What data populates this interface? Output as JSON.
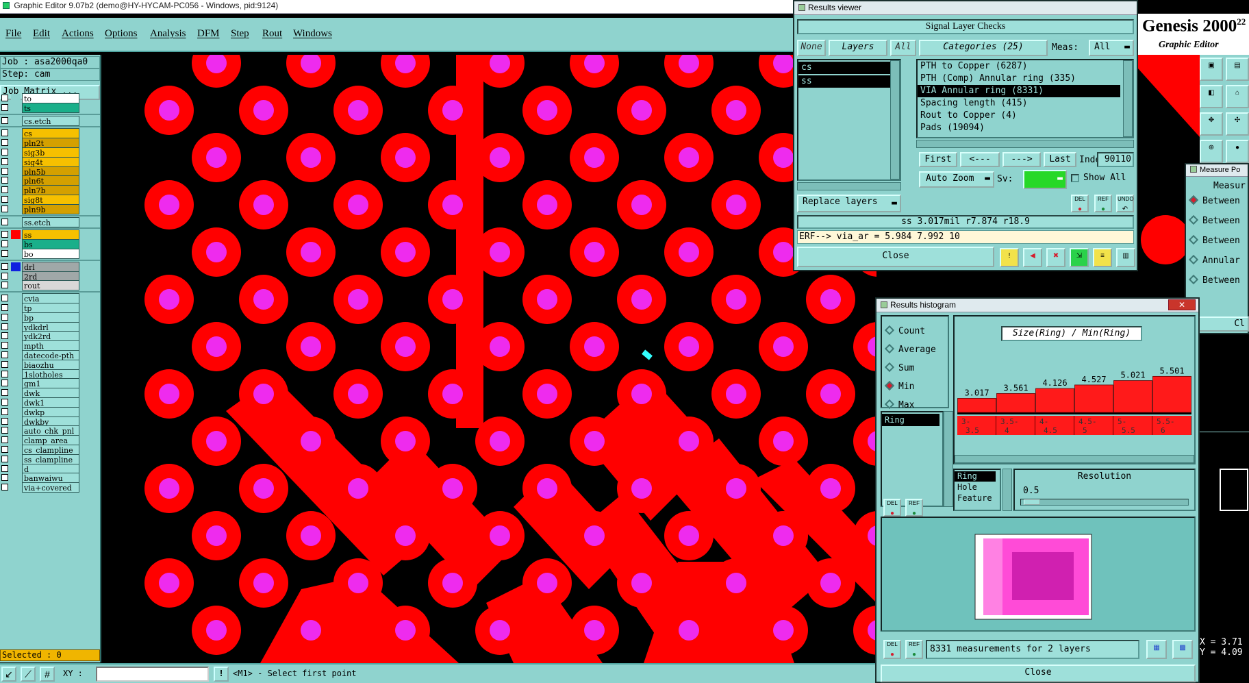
{
  "window": {
    "title": "Graphic Editor 9.07b2 (demo@HY-HYCAM-PC056 - Windows, pid:9124)"
  },
  "menu": [
    "File",
    "Edit",
    "Actions",
    "Options",
    "Analysis",
    "DFM",
    "Step",
    "Rout",
    "Windows"
  ],
  "job": {
    "job_line": "Job : asa2000qa0",
    "step_line": "Step: cam",
    "matrix_label": "Job Matrix ..."
  },
  "layers": [
    {
      "name": "to",
      "color": "#ffffff"
    },
    {
      "name": "ts",
      "color": "#1aaf8a"
    },
    {
      "name": "cs.etch",
      "color": "#9ee0da"
    },
    {
      "name": "cs",
      "color": "#f6c000"
    },
    {
      "name": "pln2t",
      "color": "#d4a000"
    },
    {
      "name": "sig3b",
      "color": "#f6c000"
    },
    {
      "name": "sig4t",
      "color": "#f6c000"
    },
    {
      "name": "pln5b",
      "color": "#d4a000"
    },
    {
      "name": "pln6t",
      "color": "#d4a000"
    },
    {
      "name": "pln7b",
      "color": "#d4a000"
    },
    {
      "name": "sig8t",
      "color": "#f6c000"
    },
    {
      "name": "pln9b",
      "color": "#d4a000"
    },
    {
      "name": "ss.etch",
      "color": "#9ee0da"
    },
    {
      "name": "ss",
      "color": "#f6c000"
    },
    {
      "name": "bs",
      "color": "#1aaf8a"
    },
    {
      "name": "bo",
      "color": "#ffffff"
    },
    {
      "name": "drl",
      "color": "#a0a8a8"
    },
    {
      "name": "2rd",
      "color": "#a0a8a8"
    },
    {
      "name": "rout",
      "color": "#d8d8d8"
    },
    {
      "name": "cvia",
      "color": "#9ee0da"
    },
    {
      "name": "tp",
      "color": "#9ee0da"
    },
    {
      "name": "bp",
      "color": "#9ee0da"
    },
    {
      "name": "ydkdrl",
      "color": "#9ee0da"
    },
    {
      "name": "ydk2rd",
      "color": "#9ee0da"
    },
    {
      "name": "mpth",
      "color": "#9ee0da"
    },
    {
      "name": "datecode-pth",
      "color": "#9ee0da"
    },
    {
      "name": "biaozhu",
      "color": "#9ee0da"
    },
    {
      "name": "1slotholes",
      "color": "#9ee0da"
    },
    {
      "name": "gm1",
      "color": "#9ee0da"
    },
    {
      "name": "dwk",
      "color": "#9ee0da"
    },
    {
      "name": "dwk1",
      "color": "#9ee0da"
    },
    {
      "name": "dwkp",
      "color": "#9ee0da"
    },
    {
      "name": "dwkby",
      "color": "#9ee0da"
    },
    {
      "name": "auto_chk_pnl",
      "color": "#9ee0da"
    },
    {
      "name": "clamp_area",
      "color": "#9ee0da"
    },
    {
      "name": "cs_clampline",
      "color": "#9ee0da"
    },
    {
      "name": "ss_clampline",
      "color": "#9ee0da"
    },
    {
      "name": "d",
      "color": "#9ee0da"
    },
    {
      "name": "banwaiwu",
      "color": "#9ee0da"
    },
    {
      "name": "via+covered",
      "color": "#9ee0da"
    }
  ],
  "selected_text": "Selected : 0",
  "status": {
    "xy_label": "XY :",
    "xy_value": "",
    "message": "<M1> - Select first point"
  },
  "genesis": {
    "title": "Genesis 2000",
    "sup": "22",
    "subtitle": "Graphic Editor"
  },
  "results_viewer": {
    "title": "Results viewer",
    "header": "Signal Layer Checks",
    "btn_none": "None",
    "btn_layers": "Layers",
    "btn_all": "All",
    "categories_label": "Categories (25)",
    "meas_label": "Meas:",
    "meas_value": "All",
    "layer_list": [
      "cs",
      "ss"
    ],
    "categories": [
      "PTH to Copper (6287)",
      "PTH (Comp) Annular ring (335)",
      "VIA Annular ring (8331)",
      "Spacing length (415)",
      "Rout to Copper (4)",
      "Pads (19094)"
    ],
    "selected_category_index": 2,
    "nav": {
      "first": "First",
      "prev": "<---",
      "next": "--->",
      "last": "Last",
      "index_label": "Index:",
      "index_value": "90110"
    },
    "auto_zoom": "Auto Zoom",
    "sv_label": "Sv:",
    "show_all": "Show All",
    "replace_layers": "Replace layers",
    "info_line": "ss 3.017mil  r7.874  r18.9",
    "erf_line": "ERF--> via_ar = 5.984 7.992 10",
    "close": "Close",
    "icons": {
      "del": "DEL",
      "ref": "REF",
      "undo": "UNDO"
    }
  },
  "measure_panel": {
    "title": "Measure Po",
    "header": "Measur",
    "options": [
      "Between",
      "Between",
      "Between",
      "Annular",
      "Between"
    ],
    "close": "Cl",
    "coords": [
      "X = 3.71",
      "Y = 4.09"
    ]
  },
  "histogram": {
    "title": "Results histogram",
    "modes": [
      "Count",
      "Average",
      "Sum",
      "Min",
      "Max"
    ],
    "selected_mode": "Min",
    "list_sel": "Ring",
    "types": [
      "Ring",
      "Hole",
      "Feature"
    ],
    "resolution_label": "Resolution",
    "resolution_value": "0.5",
    "footer": "8331 measurements for 2 layers",
    "close": "Close",
    "icons": {
      "del": "DEL",
      "ref": "REF"
    }
  },
  "chart_data": {
    "type": "bar",
    "title": "Size(Ring) / Min(Ring)",
    "categories": [
      "3-3.5",
      "3.5-4",
      "4-4.5",
      "4.5-5",
      "5-5.5",
      "5.5-6"
    ],
    "values": [
      3.017,
      3.561,
      4.126,
      4.527,
      5.021,
      5.501
    ],
    "value_labels": [
      "3.017",
      "3.561",
      "4.126",
      "4.527",
      "5.021",
      "5.501"
    ],
    "tick_top": [
      "3-",
      "3.5-",
      "4-",
      "4.5-",
      "5-",
      "5.5-"
    ],
    "tick_bottom": [
      "3.5",
      "4",
      "4.5",
      "5",
      "5.5",
      "6"
    ],
    "ylim": [
      0,
      7
    ],
    "bar_color": "#ff1a1a"
  }
}
